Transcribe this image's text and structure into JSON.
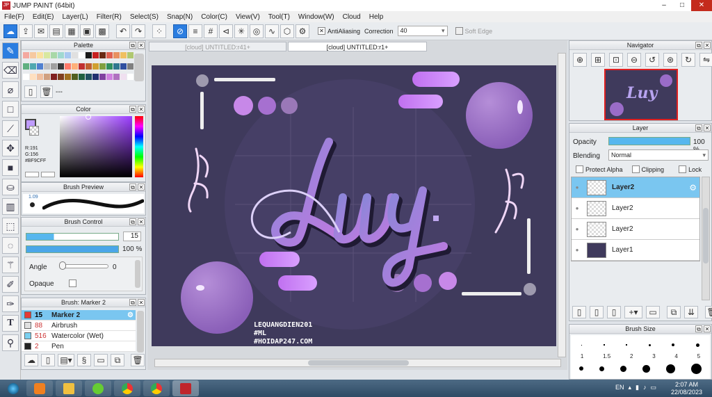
{
  "window": {
    "title": "JUMP PAINT (64bit)"
  },
  "menu": [
    "File(F)",
    "Edit(E)",
    "Layer(L)",
    "Filter(R)",
    "Select(S)",
    "Snap(N)",
    "Color(C)",
    "View(V)",
    "Tool(T)",
    "Window(W)",
    "Cloud",
    "Help"
  ],
  "toolbar": {
    "antialias_label": "AntiAliasing",
    "correction_label": "Correction",
    "correction_value": "40",
    "soft_edge_label": "Soft Edge"
  },
  "palette": {
    "title": "Palette",
    "name": "---",
    "colors": [
      "#f4a8a0",
      "#f6c9a0",
      "#fae1a0",
      "#d8e8a0",
      "#a8d8a8",
      "#a0d8d0",
      "#a8c8f0",
      "#e0e0e0",
      "#ffffff",
      "#1a1a1a",
      "#c82020",
      "#6a2a14",
      "#e06050",
      "#e89060",
      "#f0c060",
      "#b0c870",
      "#60b080",
      "#50a8b0",
      "#5080d0",
      "#c0c0c0",
      "#a0a0a0",
      "#3a3a3a",
      "#ff7a6a",
      "#ffb07a",
      "#c03030",
      "#c06030",
      "#d0a030",
      "#80a040",
      "#309060",
      "#307890",
      "#3050a0",
      "#808080",
      "#ffffff",
      "#ffe0c0",
      "#f0c0a0",
      "#d0a080",
      "#802020",
      "#804020",
      "#a07020",
      "#506020",
      "#206040",
      "#205060",
      "#203070",
      "#8040a0",
      "#d080e0",
      "#b070c0",
      "#f0e0f0",
      "#ffffff"
    ]
  },
  "color": {
    "title": "Color",
    "r": "R:191",
    "g": "G:156",
    "hex": "#BF9CFF",
    "fg": "#bf9cff"
  },
  "brush_preview": {
    "title": "Brush Preview",
    "size": "1.09"
  },
  "brush_control": {
    "title": "Brush Control",
    "size_value": "15",
    "opacity_value": "100 %",
    "angle_label": "Angle",
    "angle_value": "0",
    "opaque_label": "Opaque"
  },
  "brush_list": {
    "title": "Brush: Marker 2",
    "items": [
      {
        "size": "15",
        "name": "Marker 2",
        "color": "#e53935",
        "selected": true
      },
      {
        "size": "88",
        "name": "Airbrush",
        "color": "#e0e0e0",
        "selected": false
      },
      {
        "size": "516",
        "name": "Watercolor (Wet)",
        "color": "#7ad0f0",
        "selected": false
      },
      {
        "size": "2",
        "name": "Pen",
        "color": "#222222",
        "selected": false
      }
    ]
  },
  "tabs": [
    "[cloud] UNTITLED:r41+",
    "[cloud] UNTITLED:r1+"
  ],
  "artwork": {
    "title_text": "Luy",
    "signature_line1": "LEQUANGDIEN201",
    "signature_line2": "#ML",
    "signature_line3": "#HOIDAP247.COM"
  },
  "navigator": {
    "title": "Navigator"
  },
  "layer": {
    "title": "Layer",
    "opacity_label": "Opacity",
    "opacity_value": "100 %",
    "blending_label": "Blending",
    "blending_value": "Normal",
    "protect_alpha": "Protect Alpha",
    "clipping": "Clipping",
    "lock": "Lock",
    "items": [
      {
        "name": "Layer2",
        "selected": true
      },
      {
        "name": "Layer2",
        "selected": false
      },
      {
        "name": "Layer2",
        "selected": false
      },
      {
        "name": "Layer1",
        "selected": false
      }
    ]
  },
  "brush_size": {
    "title": "Brush Size",
    "labels": [
      "1",
      "1.5",
      "2",
      "3",
      "4",
      "5"
    ]
  },
  "taskbar": {
    "lang": "EN",
    "time": "2:07 AM",
    "date": "22/08/2023"
  }
}
